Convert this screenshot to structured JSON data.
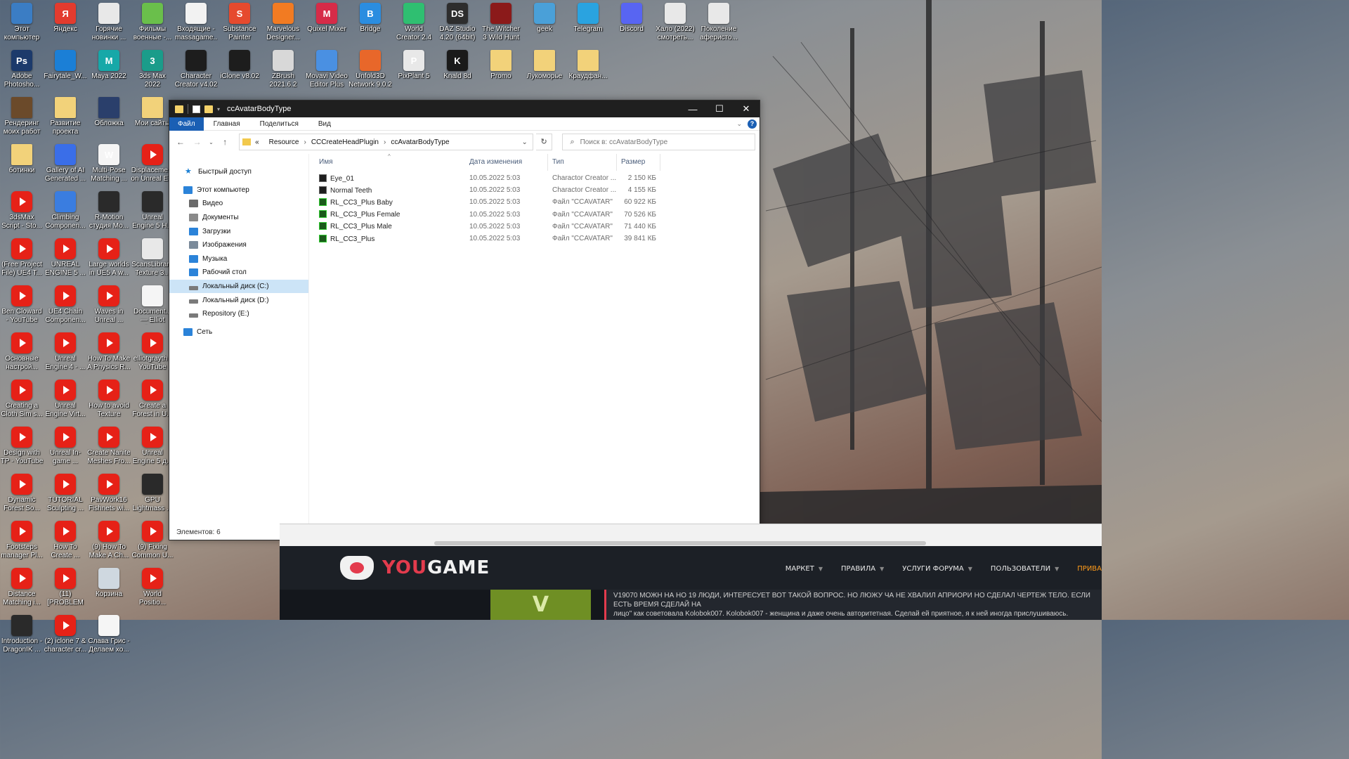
{
  "desktop": {
    "icons": [
      {
        "label": "Этот компьютер",
        "icon": "this-pc-icon",
        "color": "#3b7dc4"
      },
      {
        "label": "Яндекс",
        "icon": "yandex-icon",
        "color": "#e33b2e",
        "glyph": "Я"
      },
      {
        "label": "Горячие новинки ...",
        "icon": "chrome-shortcut-icon",
        "color": "#e8e8e8"
      },
      {
        "label": "Фильмы военные -...",
        "icon": "film-icon",
        "color": "#6abf4b"
      },
      {
        "label": "Входящие - massagame...",
        "icon": "gmail-icon",
        "color": "#f2f2f2"
      },
      {
        "label": "Substance Painter",
        "icon": "substance-painter-icon",
        "color": "#e64a2e",
        "glyph": "S"
      },
      {
        "label": "Marvelous Designer...",
        "icon": "marvelous-designer-icon",
        "color": "#f27b22"
      },
      {
        "label": "Quixel Mixer",
        "icon": "quixel-mixer-icon",
        "color": "#d62b48",
        "glyph": "M"
      },
      {
        "label": "Bridge",
        "icon": "bridge-icon",
        "color": "#2b8de0",
        "glyph": "B"
      },
      {
        "label": "World Creator 2.4",
        "icon": "world-creator-icon",
        "color": "#2fbf71"
      },
      {
        "label": "DAZ Studio 4.20 (64bit)",
        "icon": "daz-studio-icon",
        "color": "#2d2d2d",
        "glyph": "DS"
      },
      {
        "label": "The Witcher 3 Wild Hunt",
        "icon": "witcher-icon",
        "color": "#8b1a1a"
      },
      {
        "label": "geek",
        "icon": "geek-icon",
        "color": "#4aa0d8"
      },
      {
        "label": "Telegram",
        "icon": "telegram-icon",
        "color": "#2aa3e0"
      },
      {
        "label": "Discord",
        "icon": "discord-icon",
        "color": "#5865f2"
      },
      {
        "label": "Хало (2022) смотреть...",
        "icon": "chrome-shortcut-icon",
        "color": "#e8e8e8"
      },
      {
        "label": "Поколение аферисто...",
        "icon": "chrome-shortcut-icon",
        "color": "#e8e8e8"
      },
      {
        "label": "Adobe Photosho...",
        "icon": "photoshop-icon",
        "color": "#1c3a6b",
        "glyph": "Ps"
      },
      {
        "label": "Fairytale_W...",
        "icon": "fairytale-icon",
        "color": "#1b7fd6"
      },
      {
        "label": "Maya 2022",
        "icon": "maya-icon",
        "color": "#17a8a8",
        "glyph": "M"
      },
      {
        "label": "3ds Max 2022",
        "icon": "3ds-max-icon",
        "color": "#1a9c8a",
        "glyph": "3"
      },
      {
        "label": "Character Creator v4.02",
        "icon": "character-creator-icon",
        "color": "#1d1d1d"
      },
      {
        "label": "iClone v8.02",
        "icon": "iclone-icon",
        "color": "#1d1d1d"
      },
      {
        "label": "ZBrush 2021.6.2",
        "icon": "zbrush-icon",
        "color": "#d8d8d8"
      },
      {
        "label": "Movavi Video Editor Plus",
        "icon": "movavi-icon",
        "color": "#4a90e2"
      },
      {
        "label": "Unfold3D Network 9.0.2",
        "icon": "unfold3d-icon",
        "color": "#e8672a"
      },
      {
        "label": "PixPlant 5",
        "icon": "pixplant-icon",
        "color": "#e8e8e8",
        "glyph": "P"
      },
      {
        "label": "Knald 8d",
        "icon": "knald-icon",
        "color": "#1a1a1a",
        "glyph": "K"
      },
      {
        "label": "Promo",
        "icon": "folder-icon",
        "color": "#f2d27a"
      },
      {
        "label": "Лукоморье",
        "icon": "folder-icon",
        "color": "#f2d27a"
      },
      {
        "label": "Краудфан...",
        "icon": "folder-icon",
        "color": "#f2d27a"
      },
      {
        "label": "Рендеринг моих работ",
        "icon": "folder-icon",
        "color": "#6b4a2a"
      },
      {
        "label": "Развитие проекта",
        "icon": "folder-icon",
        "color": "#f2d27a"
      },
      {
        "label": "Обложка",
        "icon": "folder-icon",
        "color": "#2a3f6b"
      },
      {
        "label": "Мои сайты",
        "icon": "folder-icon",
        "color": "#f2d27a"
      },
      {
        "label": "ботинки",
        "icon": "folder-icon",
        "color": "#f2d27a"
      },
      {
        "label": "Gallery of AI Generated ...",
        "icon": "ai-gallery-icon",
        "color": "#3a6ee8"
      },
      {
        "label": "Multi-Pose Matching ...",
        "icon": "word-doc-icon",
        "color": "#f5f5f5",
        "glyph": "W"
      },
      {
        "label": "Displaceme... on Unreal E...",
        "icon": "youtube-icon",
        "color": "#e62117"
      },
      {
        "label": "3dsMax Script - Sto...",
        "icon": "youtube-icon",
        "color": "#e62117"
      },
      {
        "label": "Climbing Componen...",
        "icon": "doc-icon",
        "color": "#3a7de0"
      },
      {
        "label": "R-Motion студия Мо...",
        "icon": "rmotion-icon",
        "color": "#2a2a2a"
      },
      {
        "label": "Unreal Engine 5 H...",
        "icon": "unreal-icon",
        "color": "#2a2a2a"
      },
      {
        "label": "(Free Project File) UE4 T...",
        "icon": "youtube-icon",
        "color": "#e62117"
      },
      {
        "label": "UNREAL ENGINE 5 ...",
        "icon": "youtube-icon",
        "color": "#e62117"
      },
      {
        "label": "Large worlds in UE5 A w...",
        "icon": "youtube-icon",
        "color": "#e62117"
      },
      {
        "label": "ScansLibrar - Texture 3...",
        "icon": "scanslibrary-icon",
        "color": "#e8e8e8"
      },
      {
        "label": "Ben Cloward - YouTube",
        "icon": "youtube-icon",
        "color": "#e62117"
      },
      {
        "label": "UE4 Chain Componen...",
        "icon": "youtube-icon",
        "color": "#e62117"
      },
      {
        "label": "Waves in Unreal ...",
        "icon": "youtube-icon",
        "color": "#e62117"
      },
      {
        "label": "Document... — Elliot Gra...",
        "icon": "document-icon",
        "color": "#f5f5f5"
      },
      {
        "label": "Основные настрой...",
        "icon": "youtube-icon",
        "color": "#e62117"
      },
      {
        "label": "Unreal Engine 4 - ...",
        "icon": "youtube-icon",
        "color": "#e62117"
      },
      {
        "label": "How To Make A Physics R...",
        "icon": "youtube-icon",
        "color": "#e62117"
      },
      {
        "label": "elliotgrayth - YouTube",
        "icon": "youtube-icon",
        "color": "#e62117"
      },
      {
        "label": "Creating a Cloth Sim s...",
        "icon": "youtube-icon",
        "color": "#e62117"
      },
      {
        "label": "Unreal Engine Virt...",
        "icon": "youtube-icon",
        "color": "#e62117"
      },
      {
        "label": "How to avoid Texture Rep...",
        "icon": "youtube-icon",
        "color": "#e62117"
      },
      {
        "label": "Create a Forest in U...",
        "icon": "youtube-icon",
        "color": "#e62117"
      },
      {
        "label": "Design with TP - YouTube",
        "icon": "youtube-icon",
        "color": "#e62117"
      },
      {
        "label": "Unreal In-game ...",
        "icon": "youtube-icon",
        "color": "#e62117"
      },
      {
        "label": "Create Nanite Meshes Fro...",
        "icon": "youtube-icon",
        "color": "#e62117"
      },
      {
        "label": "Unreal Engine 5 д...",
        "icon": "youtube-icon",
        "color": "#e62117"
      },
      {
        "label": "Dynamic Forest So...",
        "icon": "youtube-icon",
        "color": "#e62117"
      },
      {
        "label": "TUTORIAL Sculpting ...",
        "icon": "youtube-icon",
        "color": "#e62117"
      },
      {
        "label": "PavWork16 Fishnets wi...",
        "icon": "youtube-icon",
        "color": "#e62117"
      },
      {
        "label": "GPU Lightmass ...",
        "icon": "gpu-lightmass-icon",
        "color": "#2a2a2a"
      },
      {
        "label": "Footsteps manager Pl...",
        "icon": "youtube-icon",
        "color": "#e62117"
      },
      {
        "label": "How To Create ...",
        "icon": "youtube-icon",
        "color": "#e62117"
      },
      {
        "label": "(9) How To Make A Ch...",
        "icon": "youtube-icon",
        "color": "#e62117"
      },
      {
        "label": "(9) Fixing Common U...",
        "icon": "youtube-icon",
        "color": "#e62117"
      },
      {
        "label": "Distance Matching i...",
        "icon": "youtube-icon",
        "color": "#e62117"
      },
      {
        "label": "(11) [PROBLEM ...",
        "icon": "youtube-icon",
        "color": "#e62117"
      },
      {
        "label": "Корзина",
        "icon": "recycle-bin-icon",
        "color": "#cfd8e0"
      },
      {
        "label": "World Positio...",
        "icon": "youtube-icon",
        "color": "#e62117"
      },
      {
        "label": "Introduction - DragonIK ...",
        "icon": "dragonik-icon",
        "color": "#2a2a2a"
      },
      {
        "label": "(2) iclone 7 & character cr...",
        "icon": "youtube-icon",
        "color": "#e62117"
      },
      {
        "label": "Слава Грис - Делаем хо...",
        "icon": "youtube-doc-icon",
        "color": "#f5f5f5"
      }
    ]
  },
  "explorer": {
    "title": "ccAvatarBodyType",
    "ribbon_tabs": [
      "Файл",
      "Главная",
      "Поделиться",
      "Вид"
    ],
    "breadcrumb": [
      "«",
      "Resource",
      "CCCreateHeadPlugin",
      "ccAvatarBodyType"
    ],
    "search_placeholder": "Поиск в: ccAvatarBodyType",
    "nav": {
      "quick_access": "Быстрый доступ",
      "this_pc": "Этот компьютер",
      "items": [
        "Видео",
        "Документы",
        "Загрузки",
        "Изображения",
        "Музыка",
        "Рабочий стол",
        "Локальный диск (C:)",
        "Локальный диск (D:)",
        "Repository (E:)"
      ],
      "network": "Сеть"
    },
    "columns": [
      "Имя",
      "Дата изменения",
      "Тип",
      "Размер"
    ],
    "files": [
      {
        "name": "Eye_01",
        "date": "10.05.2022 5:03",
        "type": "Charactor Creator ...",
        "size": "2 150 КБ",
        "icon": "cc-file-icon"
      },
      {
        "name": "Normal Teeth",
        "date": "10.05.2022 5:03",
        "type": "Charactor Creator ...",
        "size": "4 155 КБ",
        "icon": "cc-file-icon"
      },
      {
        "name": "RL_CC3_Plus Baby",
        "date": "10.05.2022 5:03",
        "type": "Файл \"CCAVATAR\"",
        "size": "60 922 КБ",
        "icon": "ccavatar-file-icon"
      },
      {
        "name": "RL_CC3_Plus Female",
        "date": "10.05.2022 5:03",
        "type": "Файл \"CCAVATAR\"",
        "size": "70 526 КБ",
        "icon": "ccavatar-file-icon"
      },
      {
        "name": "RL_CC3_Plus Male",
        "date": "10.05.2022 5:03",
        "type": "Файл \"CCAVATAR\"",
        "size": "71 440 КБ",
        "icon": "ccavatar-file-icon"
      },
      {
        "name": "RL_CC3_Plus",
        "date": "10.05.2022 5:03",
        "type": "Файл \"CCAVATAR\"",
        "size": "39 841 КБ",
        "icon": "ccavatar-file-icon"
      }
    ],
    "status": "Элементов: 6"
  },
  "browser": {
    "logo_you": "YOU",
    "logo_game": "GAME",
    "menu": [
      "МАРКЕТ",
      "ПРАВИЛА",
      "УСЛУГИ ФОРУМА",
      "ПОЛЬЗОВАТЕЛИ",
      "ПРИВА"
    ],
    "comment_line1": "V19070 МОЖН НА НО 19 ЛЮДИ, ИНТЕРЕСУЕТ ВОТ ТАКОЙ ВОПРОС. НО ЛЮЖУ ЧА НЕ ХВАЛИЛ АПРИОРИ НО СДЕЛАЛ ЧЕРТЕЖ ТЕЛО. ЕСЛИ ЕСТЬ ВРЕМЯ СДЕЛАЙ НА",
    "comment_line2": "лицо\" как советовала Kolobok007. Kolobok007 - женщина и даже очень авторитетная. Сделай ей приятное, я к ней иногда прислушиваюсь.",
    "green_letter": "V"
  },
  "colors": {
    "explorer_accent": "#1a5fb4",
    "youtube_red": "#e62117",
    "yougame_red": "#e33b4d",
    "menu_accent": "#ff9b1a"
  }
}
